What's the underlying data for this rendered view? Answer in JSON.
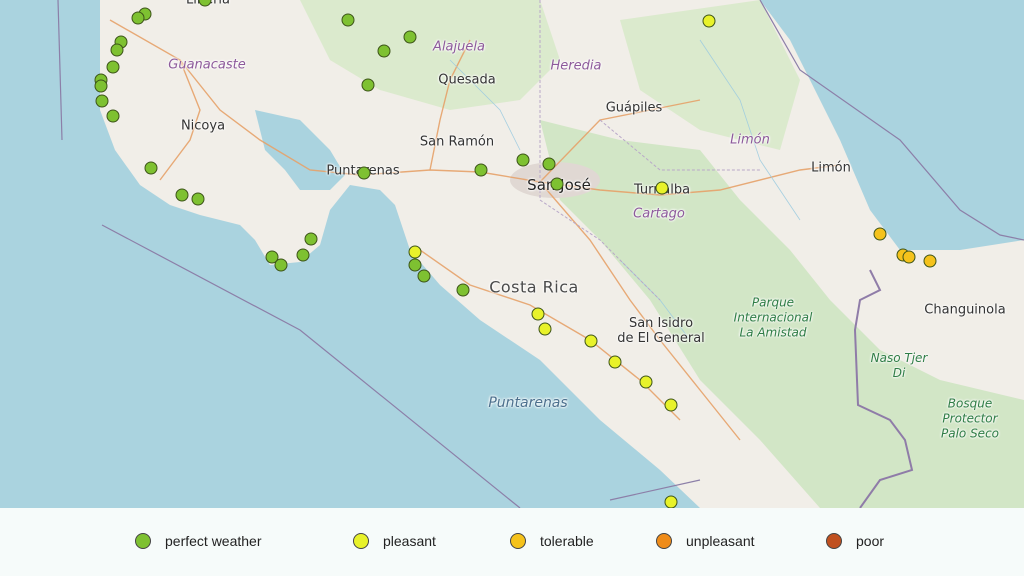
{
  "map": {
    "labels": [
      {
        "text": "Liberia",
        "class": "city"
      },
      {
        "text": "Guanacaste",
        "class": "region"
      },
      {
        "text": "Alajuela",
        "class": "region"
      },
      {
        "text": "Heredia",
        "class": "region"
      },
      {
        "text": "Quesada",
        "class": "city"
      },
      {
        "text": "Guápiles",
        "class": "city"
      },
      {
        "text": "Nicoya",
        "class": "city"
      },
      {
        "text": "San Ramón",
        "class": "city"
      },
      {
        "text": "Limón",
        "class": "region"
      },
      {
        "text": "Limón",
        "class": "city"
      },
      {
        "text": "Puntarenas",
        "class": "city"
      },
      {
        "text": "San José",
        "class": "capital"
      },
      {
        "text": "Turrialba",
        "class": "city"
      },
      {
        "text": "Cartago",
        "class": "region"
      },
      {
        "text": "Costa Rica",
        "class": "country"
      },
      {
        "text": "Changuinola",
        "class": "city"
      },
      {
        "text": "San Isidro\nde El General",
        "class": "city"
      },
      {
        "text": "Parque\nInternacional\nLa Amistad",
        "class": "park"
      },
      {
        "text": "Naso Tjer\nDi",
        "class": "park"
      },
      {
        "text": "Bosque\nProtector\nPalo Seco",
        "class": "park"
      },
      {
        "text": "Puntarenas",
        "class": "sea"
      }
    ]
  },
  "legend": {
    "items": [
      {
        "label": "perfect weather",
        "color": "#7ec131"
      },
      {
        "label": "pleasant",
        "color": "#e8f22a"
      },
      {
        "label": "tolerable",
        "color": "#f5c21b"
      },
      {
        "label": "unpleasant",
        "color": "#ef8c19"
      },
      {
        "label": "poor",
        "color": "#c0501f"
      }
    ]
  },
  "markers": {
    "counts": {
      "perfect weather": 30,
      "pleasant": 11,
      "tolerable": 4,
      "unpleasant": 0,
      "poor": 0
    }
  }
}
